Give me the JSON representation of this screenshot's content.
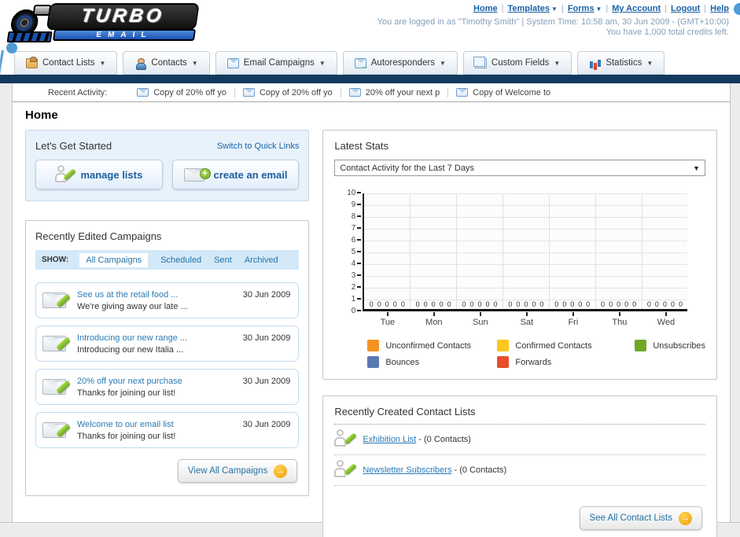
{
  "header": {
    "logo": {
      "line1": "TURBO",
      "line2": "EMAIL"
    },
    "nav_links": [
      {
        "label": "Home",
        "dropdown": false
      },
      {
        "label": "Templates",
        "dropdown": true
      },
      {
        "label": "Forms",
        "dropdown": true
      },
      {
        "label": "My Account",
        "dropdown": false
      },
      {
        "label": "Logout",
        "dropdown": false
      },
      {
        "label": "Help",
        "dropdown": false
      }
    ],
    "login_info": "You are logged in as \"Timothy Smith\" | System Time: 10:58 am, 30 Jun 2009 - (GMT+10:00)",
    "credits_info": "You have 1,000 total credits left."
  },
  "tabs": [
    {
      "label": "Contact Lists",
      "icon": "contact-lists-icon"
    },
    {
      "label": "Contacts",
      "icon": "contacts-icon"
    },
    {
      "label": "Email Campaigns",
      "icon": "email-campaigns-icon"
    },
    {
      "label": "Autoresponders",
      "icon": "autoresponders-icon"
    },
    {
      "label": "Custom Fields",
      "icon": "custom-fields-icon"
    },
    {
      "label": "Statistics",
      "icon": "statistics-icon"
    }
  ],
  "recent_activity": {
    "label": "Recent Activity:",
    "items": [
      "Copy of 20% off yo",
      "Copy of 20% off yo",
      "20% off your next p",
      "Copy of Welcome to"
    ]
  },
  "page_title": "Home",
  "get_started": {
    "title": "Let's Get Started",
    "switch_link": "Switch to Quick Links",
    "buttons": [
      {
        "label": "manage lists"
      },
      {
        "label": "create an email"
      }
    ]
  },
  "campaigns": {
    "title": "Recently Edited Campaigns",
    "show_label": "SHOW:",
    "filters": [
      "All Campaigns",
      "Scheduled",
      "Sent",
      "Archived"
    ],
    "active_filter": "All Campaigns",
    "items": [
      {
        "title": "See us at the retail food ...",
        "subtitle": "We're giving away our late ...",
        "date": "30 Jun 2009"
      },
      {
        "title": "Introducing our new range ...",
        "subtitle": "Introducing our new Italia ...",
        "date": "30 Jun 2009"
      },
      {
        "title": "20% off your next purchase",
        "subtitle": "Thanks for joining our list!",
        "date": "30 Jun 2009"
      },
      {
        "title": "Welcome to our email list",
        "subtitle": "Thanks for joining our list!",
        "date": "30 Jun 2009"
      }
    ],
    "view_all_label": "View All Campaigns"
  },
  "stats": {
    "title": "Latest Stats",
    "dropdown_value": "Contact Activity for the Last 7 Days"
  },
  "chart_data": {
    "type": "bar",
    "title": "Contact Activity for the Last 7 Days",
    "categories": [
      "Tue",
      "Mon",
      "Sun",
      "Sat",
      "Fri",
      "Thu",
      "Wed"
    ],
    "series": [
      {
        "name": "Unconfirmed Contacts",
        "color": "#F59123",
        "values": [
          0,
          0,
          0,
          0,
          0,
          0,
          0
        ]
      },
      {
        "name": "Confirmed Contacts",
        "color": "#FCC81D",
        "values": [
          0,
          0,
          0,
          0,
          0,
          0,
          0
        ]
      },
      {
        "name": "Unsubscribes",
        "color": "#70A826",
        "values": [
          0,
          0,
          0,
          0,
          0,
          0,
          0
        ]
      },
      {
        "name": "Bounces",
        "color": "#5B79B2",
        "values": [
          0,
          0,
          0,
          0,
          0,
          0,
          0
        ]
      },
      {
        "name": "Forwards",
        "color": "#E84E2A",
        "values": [
          0,
          0,
          0,
          0,
          0,
          0,
          0
        ]
      }
    ],
    "xlabel": "",
    "ylabel": "",
    "ylim": [
      0,
      10
    ],
    "ytick_step": 1,
    "grid": true,
    "legend_position": "bottom"
  },
  "contact_lists": {
    "title": "Recently Created Contact Lists",
    "items": [
      {
        "name": "Exhibition List",
        "detail": "- (0 Contacts)"
      },
      {
        "name": "Newsletter Subscribers",
        "detail": "- (0 Contacts)"
      }
    ],
    "see_all_label": "See All Contact Lists"
  },
  "colors": {
    "navy_bar": "#123A5F",
    "link_blue": "#1A62A7",
    "accent_blue_dot": "#4F9BD6"
  }
}
